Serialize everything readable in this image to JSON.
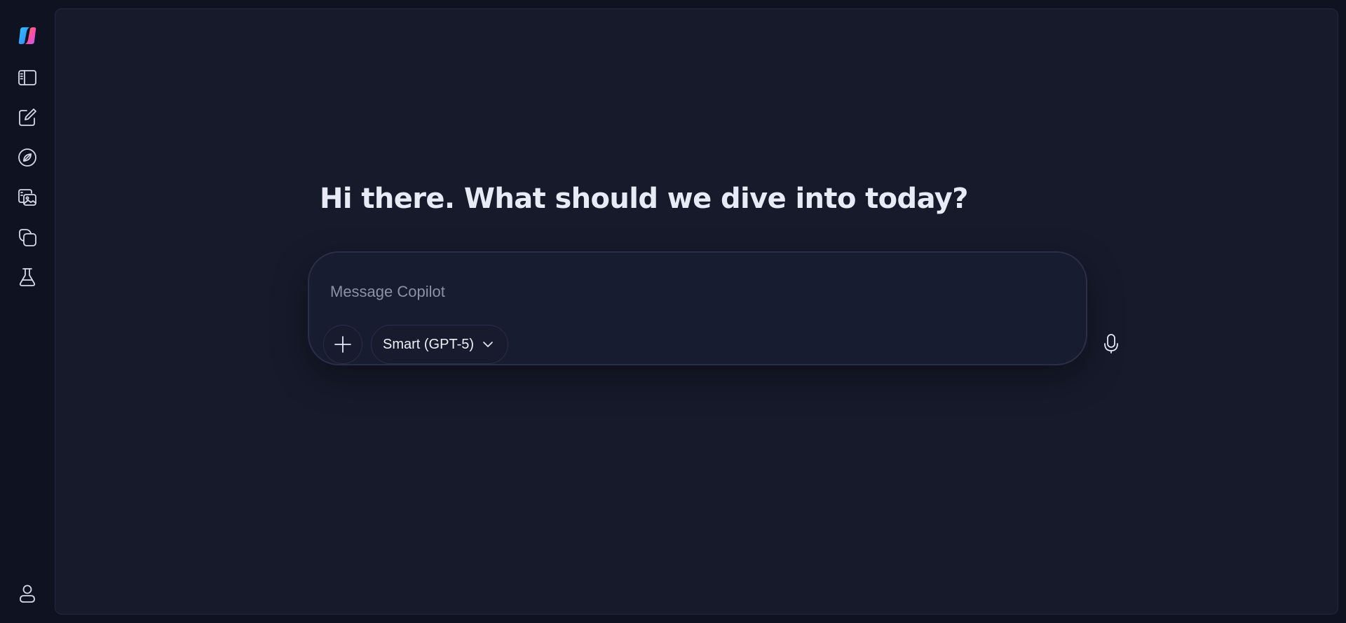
{
  "rail": {
    "items": [
      {
        "icon": "copilot-logo-icon"
      },
      {
        "icon": "sidebar-toggle-icon"
      },
      {
        "icon": "new-chat-icon"
      },
      {
        "icon": "discover-compass-icon"
      },
      {
        "icon": "image-gallery-icon"
      },
      {
        "icon": "pages-icon"
      },
      {
        "icon": "labs-flask-icon"
      }
    ],
    "profile_icon": "profile-icon"
  },
  "main": {
    "greeting": "Hi there. What should we dive into today?"
  },
  "composer": {
    "placeholder": "Message Copilot",
    "value": "",
    "attach_icon": "plus-icon",
    "model_label": "Smart (GPT-5)",
    "model_icon": "chevron-down-icon",
    "mic_icon": "microphone-icon"
  },
  "colors": {
    "background": "#0f1220",
    "panel": "#161a2b",
    "composer": "#181c30",
    "border": "#2a2f47",
    "text": "#e8ebf6",
    "placeholder": "#8b91a8"
  }
}
